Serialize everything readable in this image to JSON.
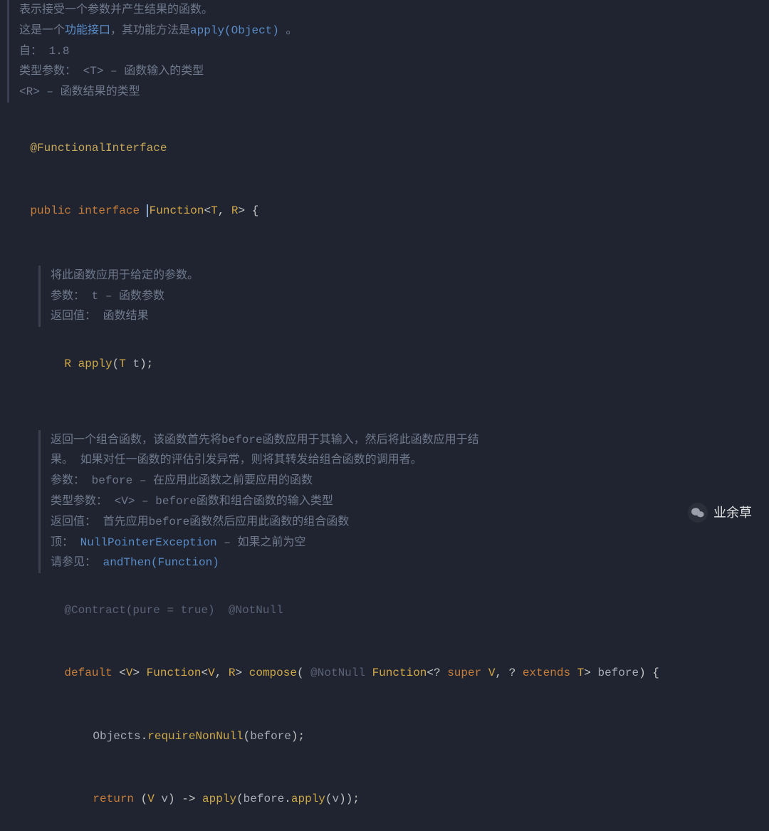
{
  "doc_top": {
    "line1": "表示接受一个参数并产生结果的函数。",
    "line2_prefix": "这是一个",
    "line2_link1": "功能接口",
    "line2_mid": "，其功能方法是",
    "line2_link2": "apply(Object)",
    "line2_suffix": " 。",
    "since_label": "自：",
    "since_val": "1.8",
    "typeparam_label": "类型参数：",
    "typeparam_t": "<T> – 函数输入的类型",
    "typeparam_r": "<R> – 函数结果的类型"
  },
  "code": {
    "annotation": "@FunctionalInterface",
    "kw_public": "public",
    "kw_interface": "interface",
    "iface_name": "Function",
    "generic_open": "<",
    "t_param": "T",
    "comma": ", ",
    "r_param": "R",
    "generic_close": ">",
    "brace_open": " {"
  },
  "apply_doc": {
    "line1": "将此函数应用于给定的参数。",
    "params_label": "参数：",
    "params_val": "t – 函数参数",
    "returns_label": "返回值：",
    "returns_val": "函数结果"
  },
  "apply_sig": {
    "ret_type": "R",
    "method": "apply",
    "paren_open": "(",
    "param_type": "T",
    "param_name": " t",
    "paren_close": ")",
    "semi": ";"
  },
  "compose_doc": {
    "line1": "返回一个组合函数，该函数首先将before函数应用于其输入，然后将此函数应用于结",
    "line2": "果。 如果对任一函数的评估引发异常，则将其转发给组合函数的调用者。",
    "params_label": "参数：",
    "params_val": "before – 在应用此函数之前要应用的函数",
    "typeparam_label": "类型参数：",
    "typeparam_val": "<V> – before函数和组合函数的输入类型",
    "returns_label": "返回值：",
    "returns_val": "首先应用before函数然后应用此函数的组合函数",
    "throws_label": "顶：",
    "throws_val": "NullPointerException",
    "throws_suffix": " – 如果之前为空",
    "see_label": "请参见：",
    "see_val": "andThen(Function)"
  },
  "compose_code": {
    "contract": "@Contract",
    "contract_args": "(pure = true)",
    "notnull": "@NotNull",
    "kw_default": "default",
    "v_generic": "<V>",
    "func_type": "Function",
    "func_generic_open": "<",
    "v_param": "V",
    "comma": ", ",
    "r_param": "R",
    "func_generic_close": ">",
    "method": "compose",
    "paren_open": "(",
    "param_anno": " @NotNull ",
    "param_type": "Function",
    "param_gen_open": "<",
    "q1": "? ",
    "kw_super": "super",
    "sp_v": " V",
    "comma2": ", ",
    "q2": "? ",
    "kw_extends": "extends",
    "sp_t": " T",
    "param_gen_close": ">",
    "param_name": " before",
    "paren_close": ")",
    "brace": " {",
    "body1_obj": "Objects",
    "body1_dot": ".",
    "body1_method": "requireNonNull",
    "body1_paren_open": "(",
    "body1_arg": "before",
    "body1_paren_close": ")",
    "body1_semi": ";",
    "ret_kw": "return",
    "lam_open": " (",
    "lam_type": "V",
    "lam_var": " v",
    "lam_close": ") ",
    "arrow": "-> ",
    "apply1": "apply",
    "ap_open": "(",
    "before_var": "before",
    "dot": ".",
    "apply2": "apply",
    "ap2_open": "(",
    "v_var": "v",
    "ap2_close": ")",
    "ap_close": ")",
    "semi": ";"
  },
  "watermark": {
    "text": "业余草"
  }
}
